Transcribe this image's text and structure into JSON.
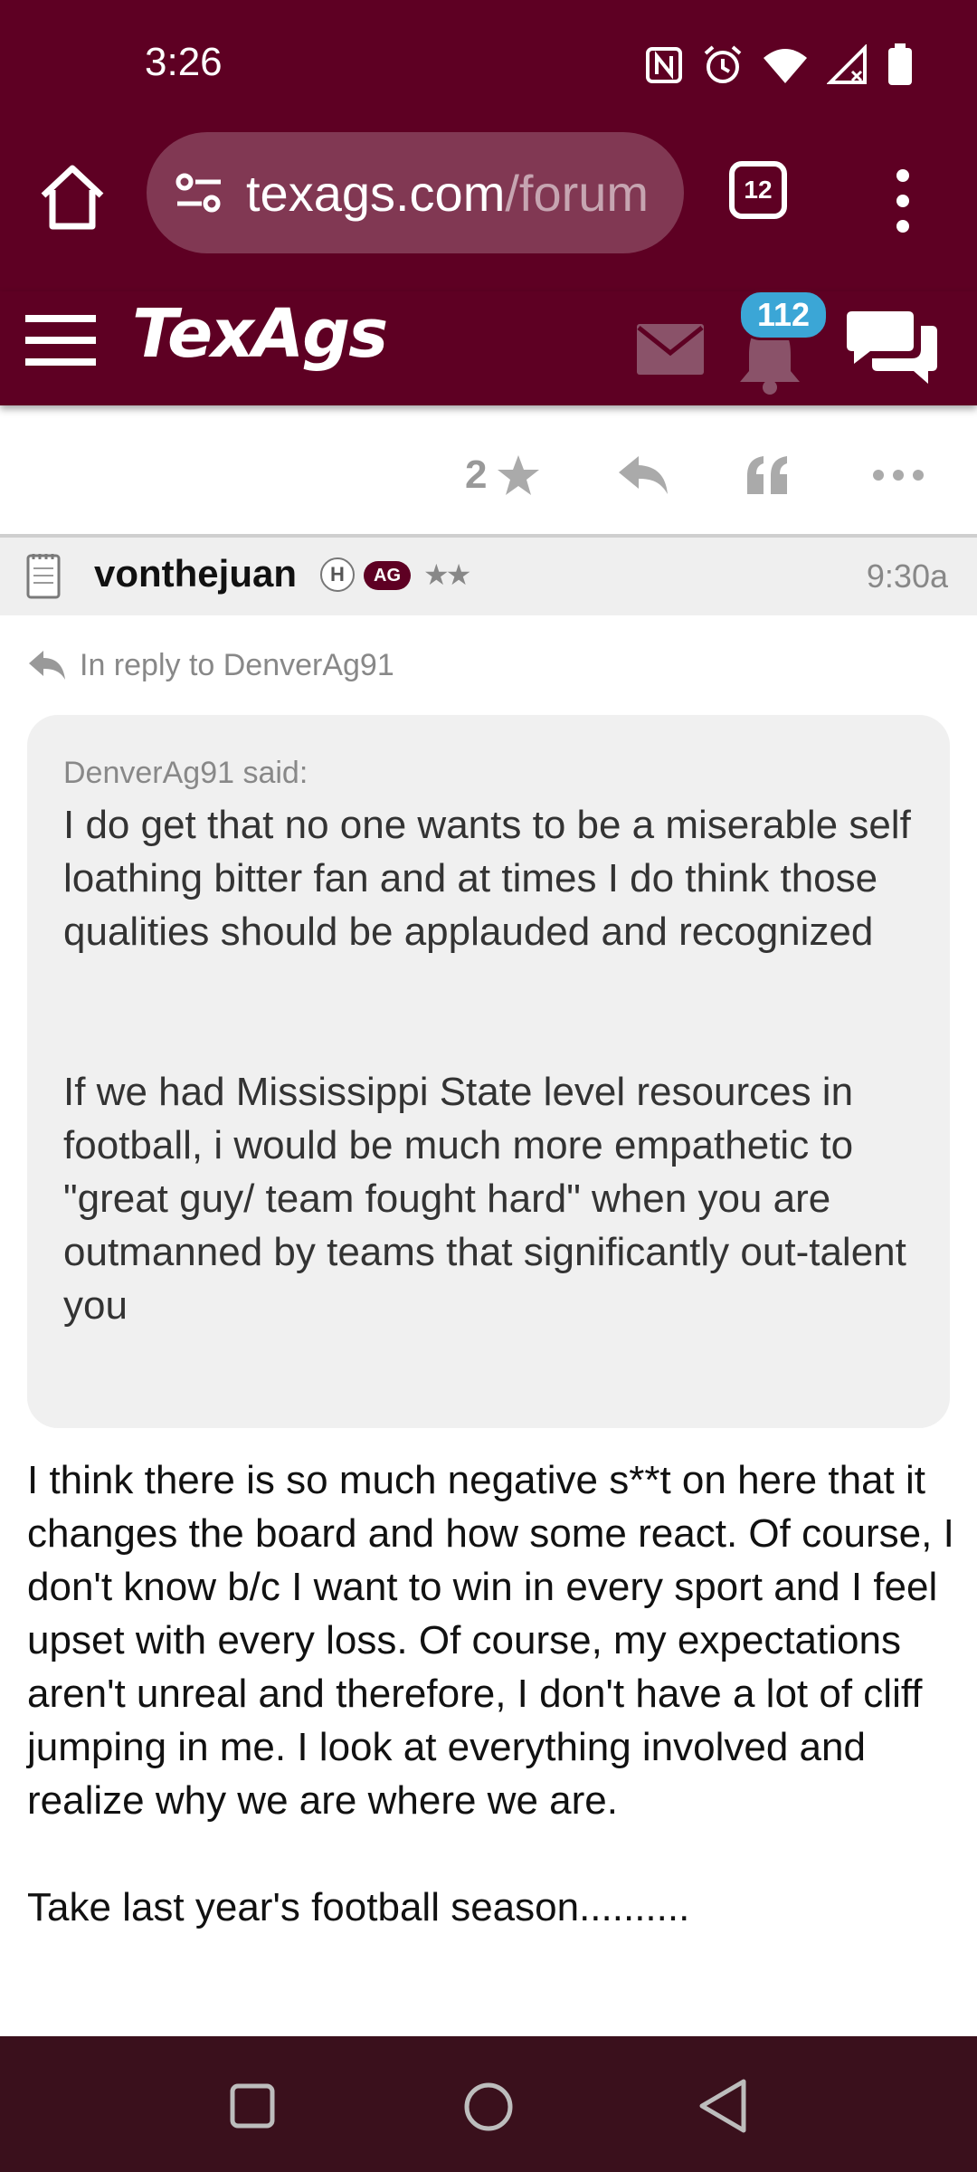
{
  "status_bar": {
    "time": "3:26"
  },
  "browser": {
    "url_domain": "texags.com",
    "url_path": "/forum",
    "tab_count": "12"
  },
  "site_header": {
    "logo_text": "TexAgs",
    "notification_count": "112"
  },
  "previous_post": {
    "rating_count": "2"
  },
  "post": {
    "username": "vonthejuan",
    "badge_h": "H",
    "badge_ag": "AG",
    "stars": "★★",
    "time": "9:30a",
    "in_reply_to": "In reply to DenverAg91",
    "quote": {
      "author_line": "DenverAg91 said:",
      "paragraph_1": "I do get that no one wants to be a miserable self loathing bitter fan and at times I do think those qualities should be applauded and recognized",
      "paragraph_2": "If we had Mississippi State level resources in football, i would be much more empathetic to \"great guy/ team fought hard\" when you are outmanned by teams that significantly out-talent you"
    },
    "body_paragraph_1": "I think there is so much negative s**t on here that it changes the board and how some react. Of course, I don't know b/c I want to win in every sport and I feel upset with every loss. Of course, my expectations aren't unreal and therefore, I don't have a lot of cliff jumping in me. I look at everything involved and realize why we are where we are.",
    "body_paragraph_2": "Take last year's football season.........."
  },
  "colors": {
    "brand_maroon": "#5e0023",
    "notification_badge": "#3ba6d6",
    "nav_bar": "#3a101c"
  },
  "icons": {
    "status": [
      "nfc-icon",
      "alarm-icon",
      "wifi-icon",
      "signal-icon",
      "battery-icon"
    ],
    "browser": [
      "home-icon",
      "site-settings-icon",
      "tabs-icon",
      "more-vert-icon"
    ],
    "header": [
      "hamburger-icon",
      "mail-icon",
      "bell-icon",
      "chat-icon"
    ],
    "actions": [
      "star-icon",
      "reply-icon",
      "quote-icon",
      "more-horiz-icon"
    ],
    "nav": [
      "recents-icon",
      "home-circle-icon",
      "back-icon"
    ]
  }
}
